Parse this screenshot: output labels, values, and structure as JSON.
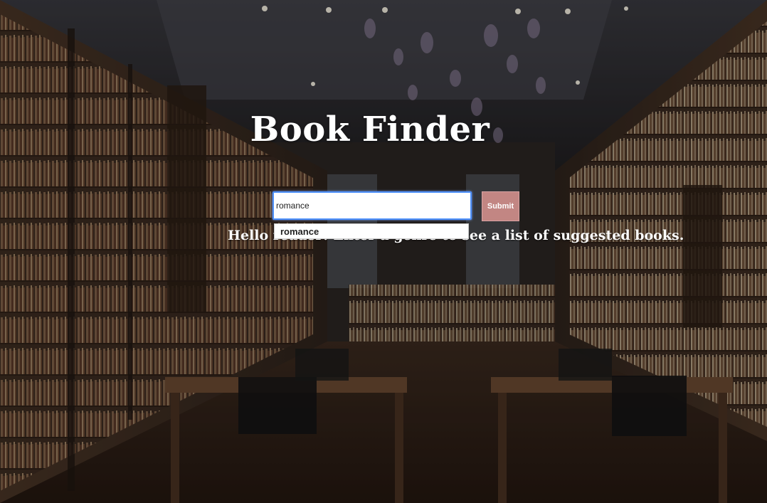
{
  "header": {
    "title": "Book Finder"
  },
  "search": {
    "value": "romance",
    "submit_label": "Submit",
    "autocomplete": [
      "romance"
    ]
  },
  "message": {
    "text": "Hello reader! Enter a genre to see a list of suggested books."
  },
  "colors": {
    "accent": "#c28683",
    "input_focus": "#4d90fe",
    "text": "#ffffff"
  }
}
